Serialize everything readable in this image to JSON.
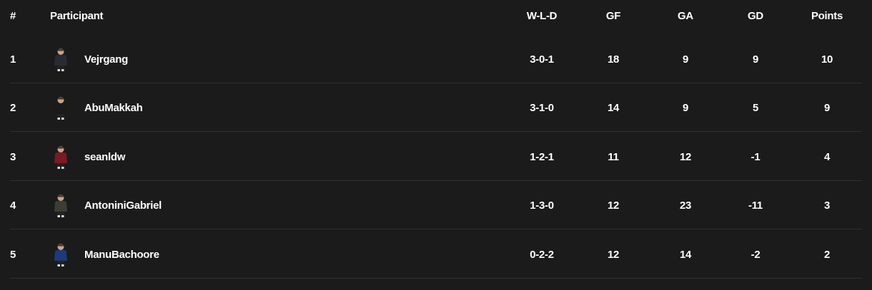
{
  "table": {
    "headers": {
      "rank": "#",
      "participant": "Participant",
      "wld": "W-L-D",
      "gf": "GF",
      "ga": "GA",
      "gd": "GD",
      "points": "Points"
    },
    "rows": [
      {
        "rank": "1",
        "name": "Vejrgang",
        "wld": "3-0-1",
        "gf": "18",
        "ga": "9",
        "gd": "9",
        "points": "10",
        "kit": "#2a2a35"
      },
      {
        "rank": "2",
        "name": "AbuMakkah",
        "wld": "3-1-0",
        "gf": "14",
        "ga": "9",
        "gd": "5",
        "points": "9",
        "kit": "#1a1a1a"
      },
      {
        "rank": "3",
        "name": "seanldw",
        "wld": "1-2-1",
        "gf": "11",
        "ga": "12",
        "gd": "-1",
        "points": "4",
        "kit": "#7a1a22"
      },
      {
        "rank": "4",
        "name": "AntoniniGabriel",
        "wld": "1-3-0",
        "gf": "12",
        "ga": "23",
        "gd": "-11",
        "points": "3",
        "kit": "#3a3f33"
      },
      {
        "rank": "5",
        "name": "ManuBachoore",
        "wld": "0-2-2",
        "gf": "12",
        "ga": "14",
        "gd": "-2",
        "points": "2",
        "kit": "#1f3a78"
      }
    ]
  },
  "colors": {
    "background": "#1b1b1b",
    "text": "#ffffff",
    "divider": "#2f2f2f"
  }
}
